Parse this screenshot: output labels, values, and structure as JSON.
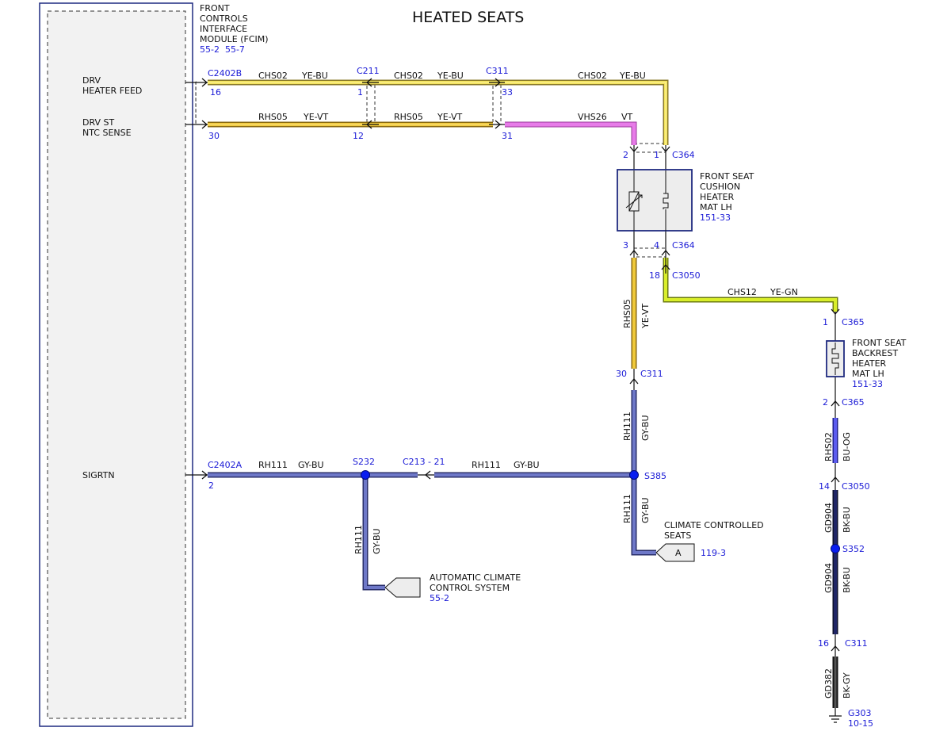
{
  "title": "HEATED SEATS",
  "colors": {
    "ye_bu_core": "#f2e25a",
    "ye_bu_edge": "#8a7a2a",
    "ye_vt_core": "#f0c93a",
    "vt_core": "#e77be8",
    "ye_gn_core": "#d9ee2a",
    "gy_bu_core": "#6e78c8",
    "gy_bu_edge": "#2a2f6a",
    "bu_og_core": "#5c5cf0",
    "bk_bu_core": "#1f2566",
    "bk_gy_core": "#444444",
    "ref_text": "#1a1ad6",
    "box_stroke": "#1f2a80",
    "splice": "#0a1ef0"
  },
  "module": {
    "name": "FRONT CONTROLS INTERFACE MODULE (FCIM)",
    "lines": [
      "FRONT",
      "CONTROLS",
      "INTERFACE",
      "MODULE (FCIM)"
    ],
    "refs": "55-2  55-7",
    "pins": [
      {
        "label_lines": [
          "DRV",
          "HEATER FEED"
        ],
        "connector": "C2402B",
        "pin": "16"
      },
      {
        "label_lines": [
          "DRV ST",
          "NTC SENSE"
        ],
        "connector": "",
        "pin": "30"
      },
      {
        "label_lines": [
          "SIGRTN"
        ],
        "connector": "C2402A",
        "pin": "2"
      }
    ]
  },
  "wires": {
    "w1": {
      "circuit": "CHS02",
      "color": "YE-BU"
    },
    "w2": {
      "circuit": "CHS02",
      "color": "YE-BU"
    },
    "w3": {
      "circuit": "CHS02",
      "color": "YE-BU"
    },
    "w4": {
      "circuit": "RHS05",
      "color": "YE-VT"
    },
    "w5": {
      "circuit": "RHS05",
      "color": "YE-VT"
    },
    "w6": {
      "circuit": "VHS26",
      "color": "VT"
    },
    "w7": {
      "circuit": "RHS05",
      "color": "YE-VT"
    },
    "w8": {
      "circuit": "CHS12",
      "color": "YE-GN"
    },
    "w9": {
      "circuit": "RH111",
      "color": "GY-BU"
    },
    "w10": {
      "circuit": "RH111",
      "color": "GY-BU"
    },
    "w11": {
      "circuit": "RH111",
      "color": "GY-BU"
    },
    "w12": {
      "circuit": "RH111",
      "color": "GY-BU"
    },
    "w13": {
      "circuit": "RH111",
      "color": "GY-BU"
    },
    "w14": {
      "circuit": "RHS02",
      "color": "BU-OG"
    },
    "w15": {
      "circuit": "GD904",
      "color": "BK-BU"
    },
    "w16": {
      "circuit": "GD904",
      "color": "BK-BU"
    },
    "w17": {
      "circuit": "GD382",
      "color": "BK-GY"
    }
  },
  "connectors": {
    "c211": {
      "name": "C211",
      "pin_a": "1",
      "pin_b": "12"
    },
    "c311_top": {
      "name": "C311",
      "pin_a": "33",
      "pin_b": "31"
    },
    "c364_top": {
      "name": "C364",
      "pin_a": "2",
      "pin_b": "1"
    },
    "c364_bot": {
      "name": "C364",
      "pin_a": "3",
      "pin_b": "4"
    },
    "c3050_top": {
      "name": "C3050",
      "pin": "18"
    },
    "c311_mid": {
      "name": "C311",
      "pin": "30"
    },
    "c213": {
      "name": "C213",
      "pin": "- 21"
    },
    "c365_top": {
      "name": "C365",
      "pin": "1"
    },
    "c365_bot": {
      "name": "C365",
      "pin": "2"
    },
    "c3050_bot": {
      "name": "C3050",
      "pin": "14"
    },
    "c311_bot": {
      "name": "C311",
      "pin": "16"
    }
  },
  "splices": {
    "s232": "S232",
    "s385": "S385",
    "s352": "S352"
  },
  "components": {
    "cushion": {
      "lines": [
        "FRONT SEAT",
        "CUSHION",
        "HEATER",
        "MAT LH"
      ],
      "ref": "151-33"
    },
    "backrest": {
      "lines": [
        "FRONT SEAT",
        "BACKREST",
        "HEATER",
        "MAT LH"
      ],
      "ref": "151-33"
    }
  },
  "offpage": {
    "climate_seats": {
      "letter": "A",
      "lines": [
        "CLIMATE CONTROLLED",
        "SEATS"
      ],
      "ref": "119-3"
    },
    "acc": {
      "lines": [
        "AUTOMATIC CLIMATE",
        "CONTROL SYSTEM"
      ],
      "ref": "55-2"
    }
  },
  "ground": {
    "name": "G303",
    "ref": "10-15"
  }
}
